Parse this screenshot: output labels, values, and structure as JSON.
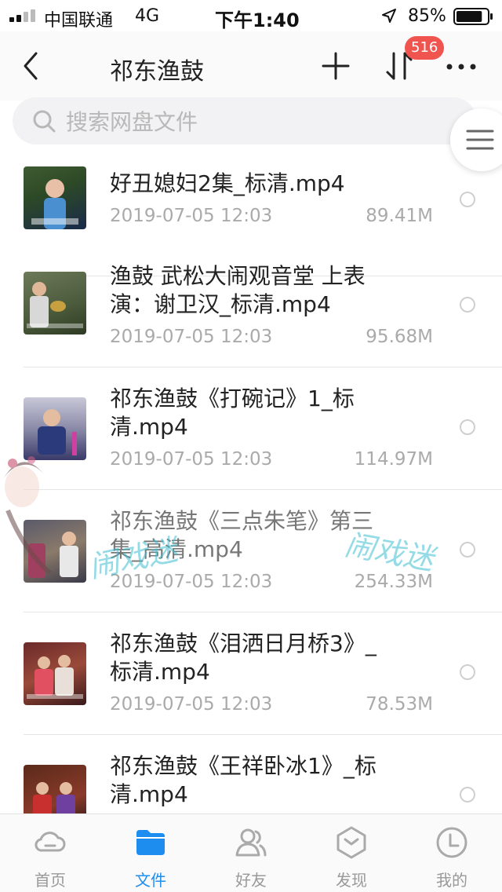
{
  "status_bar": {
    "carrier": "中国联通",
    "network": "4G",
    "time": "下午1:40",
    "battery_percent": "85%",
    "battery_level": 0.85
  },
  "nav": {
    "title": "祁东渔鼓",
    "badge_count": "516",
    "back_icon": "chevron-left-icon",
    "add_icon": "plus-icon",
    "sort_icon": "sort-icon",
    "more_icon": "more-dots-icon"
  },
  "search": {
    "placeholder": "搜索网盘文件"
  },
  "files": [
    {
      "name": "好丑媳妇2集_标清.mp4",
      "date": "2019-07-05 12:03",
      "size": "89.41M"
    },
    {
      "name": "渔鼓 武松大闹观音堂  上表演：谢卫汉_标清.mp4",
      "date": "2019-07-05 12:03",
      "size": "95.68M"
    },
    {
      "name": "祁东渔鼓《打碗记》1_标清.mp4",
      "date": "2019-07-05 12:03",
      "size": "114.97M"
    },
    {
      "name": "祁东渔鼓《三点朱笔》第三集_高清.mp4",
      "date": "2019-07-05 12:03",
      "size": "254.33M"
    },
    {
      "name": "祁东渔鼓《泪洒日月桥3》_标清.mp4",
      "date": "2019-07-05 12:03",
      "size": "78.53M"
    },
    {
      "name": "祁东渔鼓《王祥卧冰1》_标清.mp4",
      "date": "",
      "size": ""
    }
  ],
  "watermark": {
    "text_left": "闹戏迷",
    "text_right": "闹戏迷"
  },
  "tabs": [
    {
      "label": "首页",
      "icon": "cloud-icon",
      "active": false
    },
    {
      "label": "文件",
      "icon": "folder-icon",
      "active": true
    },
    {
      "label": "好友",
      "icon": "friends-icon",
      "active": false
    },
    {
      "label": "发现",
      "icon": "discover-icon",
      "active": false
    },
    {
      "label": "我的",
      "icon": "profile-icon",
      "active": false
    }
  ],
  "colors": {
    "accent": "#1e8df0",
    "badge": "#f0544f",
    "inactive": "#999999"
  }
}
